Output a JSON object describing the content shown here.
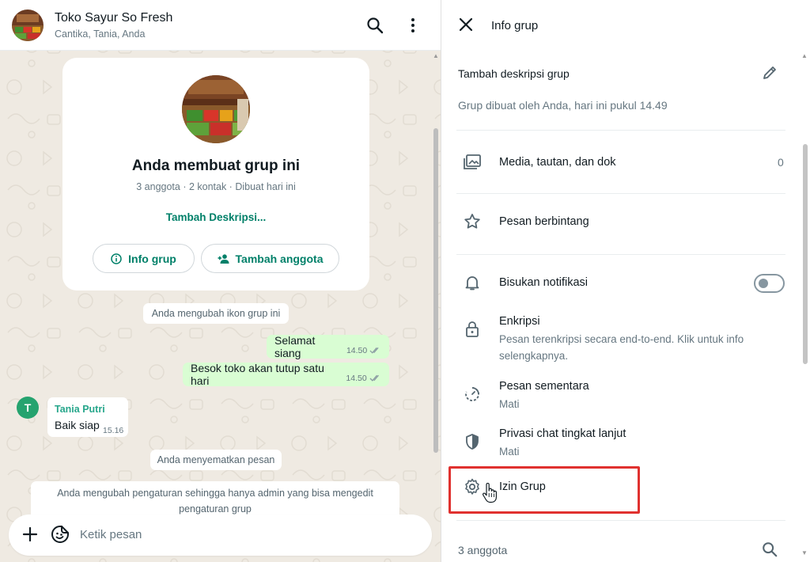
{
  "chat": {
    "header": {
      "title": "Toko Sayur So Fresh",
      "subtitle": "Cantika, Tania, Anda"
    },
    "group_card": {
      "title": "Anda membuat grup ini",
      "meta": "3 anggota · 2 kontak · Dibuat hari ini",
      "add_description": "Tambah Deskripsi...",
      "info_button": "Info grup",
      "add_member_button": "Tambah anggota"
    },
    "messages": [
      {
        "type": "system",
        "text": "Anda mengubah ikon grup ini"
      },
      {
        "type": "outgoing",
        "text": "Selamat siang",
        "time": "14.50"
      },
      {
        "type": "outgoing",
        "text": "Besok toko akan tutup satu hari",
        "time": "14.50"
      },
      {
        "type": "incoming",
        "sender": "Tania Putri",
        "avatar_letter": "T",
        "text": "Baik siap",
        "time": "15.16"
      },
      {
        "type": "system",
        "text": "Anda menyematkan pesan"
      },
      {
        "type": "system",
        "text": "Anda mengubah pengaturan sehingga hanya admin yang bisa mengedit pengaturan grup"
      }
    ],
    "composer": {
      "placeholder": "Ketik pesan"
    }
  },
  "info_panel": {
    "title": "Info grup",
    "description_add": "Tambah deskripsi grup",
    "created_text": "Grup dibuat oleh Anda, hari ini pukul 14.49",
    "media": {
      "label": "Media, tautan, dan dok",
      "count": "0"
    },
    "starred": {
      "label": "Pesan berbintang"
    },
    "mute": {
      "label": "Bisukan notifikasi",
      "enabled": false
    },
    "encryption": {
      "label": "Enkripsi",
      "sub": "Pesan terenkripsi secara end-to-end. Klik untuk info selengkapnya."
    },
    "disappearing": {
      "label": "Pesan sementara",
      "sub": "Mati"
    },
    "privacy": {
      "label": "Privasi chat tingkat lanjut",
      "sub": "Mati"
    },
    "permissions": {
      "label": "Izin Grup",
      "highlighted": true
    },
    "members": {
      "label": "3 anggota"
    }
  },
  "colors": {
    "accent_green": "#008069",
    "outgoing_bubble": "#d9fdd3",
    "chat_background": "#efeae2",
    "highlight_red": "#e0312f",
    "sender_name": "#26a68b"
  },
  "icons": [
    "search-icon",
    "menu-dots-icon",
    "info-icon",
    "add-person-icon",
    "double-check-icon",
    "plus-icon",
    "sticker-icon",
    "close-icon",
    "pencil-icon",
    "media-folder-icon",
    "star-icon",
    "bell-icon",
    "lock-icon",
    "timer-icon",
    "shield-icon",
    "gear-icon",
    "hand-cursor-icon"
  ]
}
